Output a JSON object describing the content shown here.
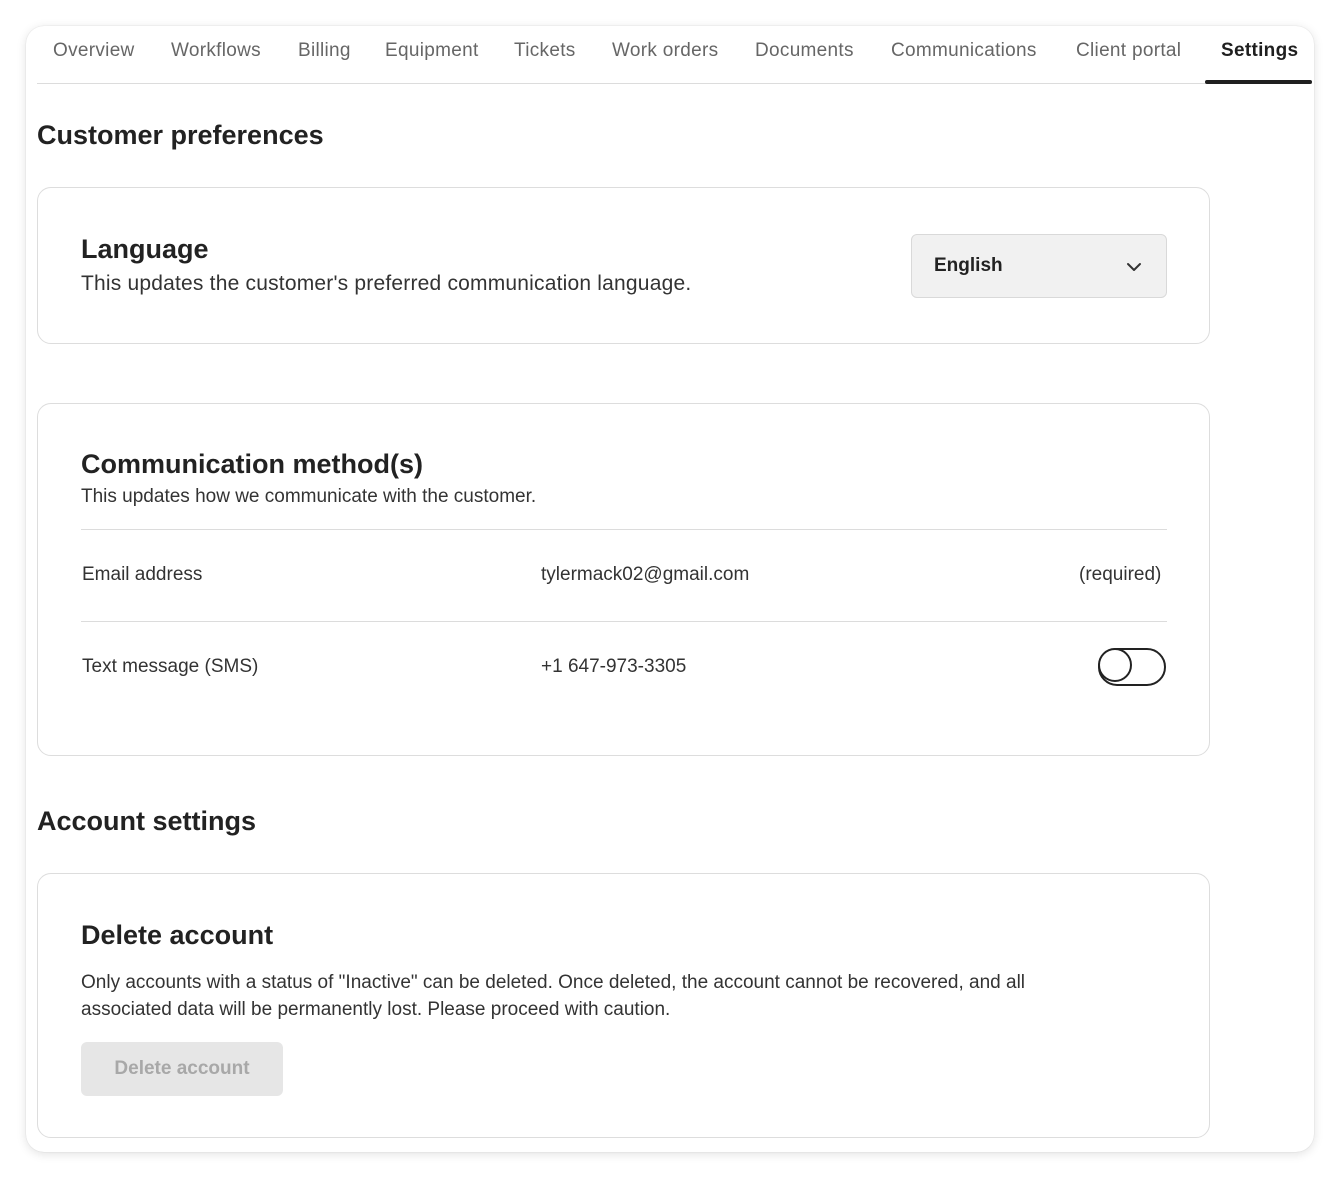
{
  "tabs": [
    {
      "label": "Overview"
    },
    {
      "label": "Workflows"
    },
    {
      "label": "Billing"
    },
    {
      "label": "Equipment"
    },
    {
      "label": "Tickets"
    },
    {
      "label": "Work orders"
    },
    {
      "label": "Documents"
    },
    {
      "label": "Communications"
    },
    {
      "label": "Client portal"
    },
    {
      "label": "Settings",
      "active": true
    }
  ],
  "customer_preferences": {
    "title": "Customer preferences",
    "language": {
      "title": "Language",
      "description": "This updates the customer's preferred communication language.",
      "selected": "English"
    },
    "communication": {
      "title": "Communication method(s)",
      "description": "This updates how we communicate with the customer.",
      "email": {
        "label": "Email address",
        "value": "tylermack02@gmail.com",
        "note": "(required)"
      },
      "sms": {
        "label": "Text message (SMS)",
        "value": "+1 647-973-3305",
        "enabled": false
      }
    }
  },
  "account_settings": {
    "title": "Account settings",
    "delete": {
      "title": "Delete account",
      "description_line1": "Only accounts with a status of \"Inactive\" can be deleted. Once deleted, the account cannot be recovered, and all",
      "description_line2": "associated data will be permanently lost. Please proceed with caution.",
      "button_label": "Delete account"
    }
  }
}
